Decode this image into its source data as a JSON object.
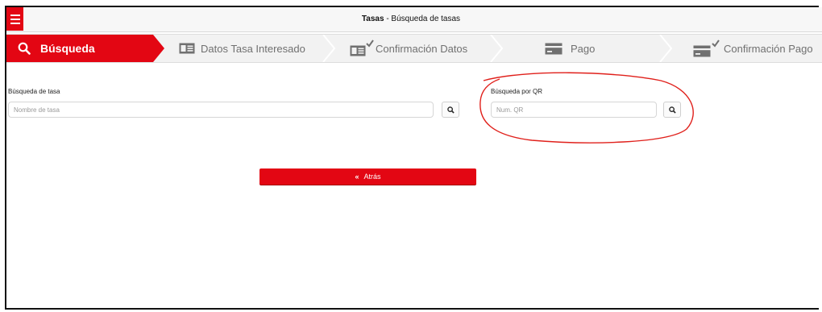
{
  "header": {
    "title_bold": "Tasas",
    "title_rest": " - Búsqueda de tasas"
  },
  "steps": [
    {
      "label": "Búsqueda",
      "icon": "search-icon",
      "active": true
    },
    {
      "label": "Datos Tasa Interesado",
      "icon": "id-card-icon",
      "active": false
    },
    {
      "label": "Confirmación Datos",
      "icon": "id-card-check-icon",
      "active": false
    },
    {
      "label": "Pago",
      "icon": "credit-card-icon",
      "active": false
    },
    {
      "label": "Confirmación Pago",
      "icon": "credit-card-check-icon",
      "active": false
    }
  ],
  "search_tasa": {
    "label": "Búsqueda de tasa",
    "placeholder": "Nombre de tasa",
    "value": ""
  },
  "search_qr": {
    "label": "Búsqueda por QR",
    "placeholder": "Num. QR",
    "value": ""
  },
  "back_button": {
    "label": "Atrás"
  },
  "colors": {
    "accent": "#e30613",
    "step_bar": "#f2f2f2",
    "annotation": "#e0201b"
  }
}
